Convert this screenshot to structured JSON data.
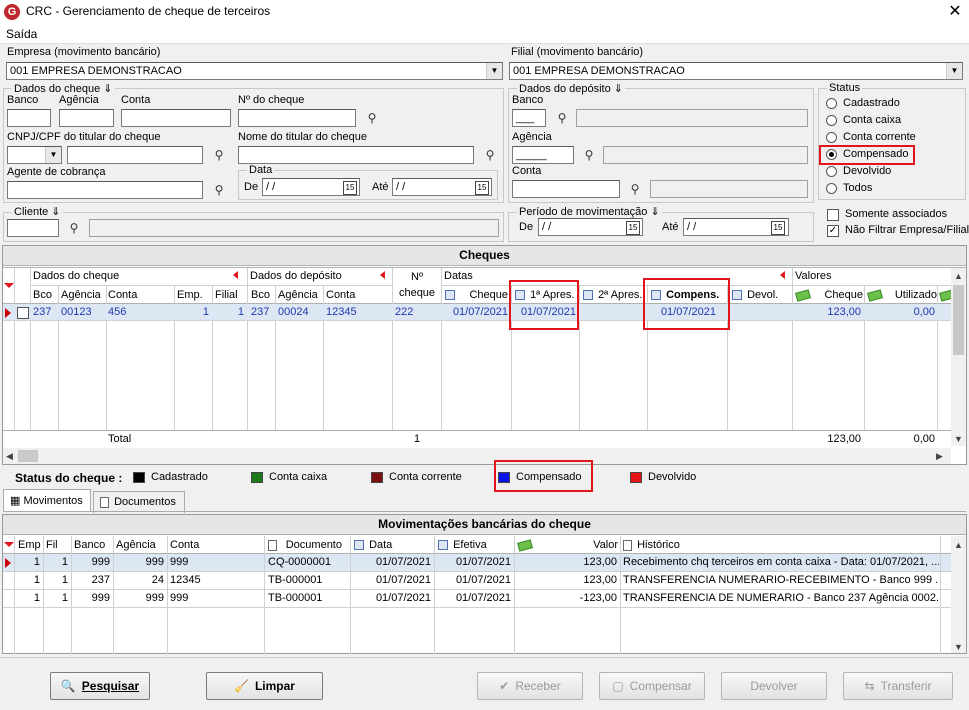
{
  "window": {
    "title": "CRC - Gerenciamento de cheque de terceiros",
    "close": "✕",
    "app_icon": "G"
  },
  "menu": {
    "saida": "Saída"
  },
  "empresa": {
    "label": "Empresa (movimento bancário)",
    "value": "001 EMPRESA DEMONSTRACAO"
  },
  "filial": {
    "label": "Filial (movimento bancário)",
    "value": "001 EMPRESA DEMONSTRACAO"
  },
  "dados_cheque": {
    "title": "Dados do cheque",
    "banco_label": "Banco",
    "agencia_label": "Agência",
    "conta_label": "Conta",
    "num_cheque_label": "Nº do cheque",
    "cnpj_label": "CNPJ/CPF do titular do cheque",
    "nome_label": "Nome do titular do cheque",
    "agente_label": "Agente de cobrança",
    "data_title": "Data",
    "de_label": "De",
    "ate_label": "Até",
    "de_value": " /  /",
    "ate_value": " /  /"
  },
  "dados_deposito": {
    "title": "Dados do depósito",
    "banco_label": "Banco",
    "agencia_label": "Agência",
    "conta_label": "Conta",
    "banco_value": "___",
    "agencia_value": "_____"
  },
  "cliente": {
    "title": "Cliente"
  },
  "periodo": {
    "title": "Período de movimentação",
    "de_label": "De",
    "ate_label": "Até",
    "de_value": " /  /",
    "ate_value": " /  /"
  },
  "status": {
    "title": "Status",
    "options": [
      "Cadastrado",
      "Conta caixa",
      "Conta corrente",
      "Compensado",
      "Devolvido",
      "Todos"
    ],
    "selected": "Compensado"
  },
  "filters": {
    "somente_associados": "Somente associados",
    "nao_filtrar": "Não Filtrar Empresa/Filial"
  },
  "cheques": {
    "title": "Cheques",
    "groups": {
      "dados_cheque": "Dados do cheque",
      "dados_deposito": "Dados do depósito",
      "num": "Nº",
      "num2": "cheque",
      "datas": "Datas",
      "valores": "Valores"
    },
    "columns": {
      "bco": "Bco",
      "agencia": "Agência",
      "conta": "Conta",
      "emp": "Emp.",
      "filial": "Filial",
      "dep_bco": "Bco",
      "dep_agencia": "Agência",
      "dep_conta": "Conta",
      "cheque_date": "Cheque",
      "apres1": "1ª Apres.",
      "apres2": "2ª Apres.",
      "compens": "Compens.",
      "devol": "Devol.",
      "valor_cheque": "Cheque",
      "utilizado": "Utilizado"
    },
    "row": {
      "bco": "237",
      "agencia": "00123",
      "conta": "456",
      "emp": "1",
      "filial": "1",
      "dep_bco": "237",
      "dep_agencia": "00024",
      "dep_conta": "12345",
      "num": "222",
      "cheque_date": "01/07/2021",
      "apres1": "01/07/2021",
      "apres2": "",
      "compens": "01/07/2021",
      "devol": "",
      "valor": "123,00",
      "utilizado": "0,00"
    },
    "total": {
      "label": "Total",
      "count": "1",
      "valor": "123,00",
      "utilizado": "0,00"
    }
  },
  "legend": {
    "title": "Status do cheque :",
    "items": [
      {
        "label": "Cadastrado",
        "color": "#000000"
      },
      {
        "label": "Conta caixa",
        "color": "#1a7a1a"
      },
      {
        "label": "Conta corrente",
        "color": "#7a0f0f"
      },
      {
        "label": "Compensado",
        "color": "#0a14e6"
      },
      {
        "label": "Devolvido",
        "color": "#e61414"
      }
    ]
  },
  "tabs": {
    "movimentos": "Movimentos",
    "documentos": "Documentos"
  },
  "movimentacoes": {
    "title": "Movimentações bancárias do cheque",
    "columns": {
      "emp": "Emp",
      "fil": "Fil",
      "banco": "Banco",
      "agencia": "Agência",
      "conta": "Conta",
      "documento": "Documento",
      "data": "Data",
      "efetiva": "Efetiva",
      "valor": "Valor",
      "historico": "Histórico"
    },
    "rows": [
      {
        "emp": "1",
        "fil": "1",
        "banco": "999",
        "agencia": "999",
        "conta": "999",
        "documento": "CQ-0000001",
        "data": "01/07/2021",
        "efetiva": "01/07/2021",
        "valor": "123,00",
        "historico": "Recebimento chq terceiros em conta caixa - Data: 01/07/2021, ..."
      },
      {
        "emp": "1",
        "fil": "1",
        "banco": "237",
        "agencia": "24",
        "conta": "12345",
        "documento": "TB-000001",
        "data": "01/07/2021",
        "efetiva": "01/07/2021",
        "valor": "123,00",
        "historico": "TRANSFERENCIA NUMERARIO-RECEBIMENTO - Banco 999 ..."
      },
      {
        "emp": "1",
        "fil": "1",
        "banco": "999",
        "agencia": "999",
        "conta": "999",
        "documento": "TB-000001",
        "data": "01/07/2021",
        "efetiva": "01/07/2021",
        "valor": "-123,00",
        "historico": "TRANSFERENCIA DE NUMERARIO - Banco 237 Agência 0002..."
      }
    ]
  },
  "buttons": {
    "pesquisar": "Pesquisar",
    "limpar": "Limpar",
    "receber": "Receber",
    "compensar": "Compensar",
    "devolver": "Devolver",
    "transferir": "Transferir"
  }
}
